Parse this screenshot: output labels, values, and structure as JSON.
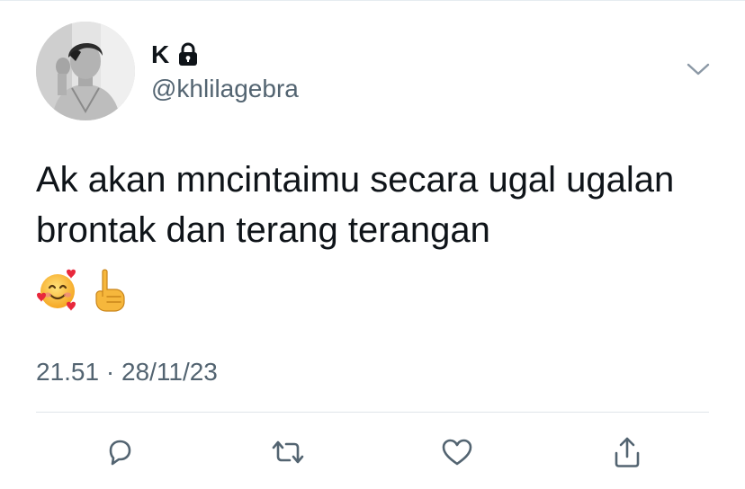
{
  "tweet": {
    "author": {
      "display_name": "K",
      "handle": "@khlilagebra",
      "protected_icon": "lock-icon",
      "avatar": "avatar-photo"
    },
    "text": "Ak akan mncintaimu secara ugal ugalan brontak dan terang terangan",
    "emojis": [
      "smiling-face-with-hearts",
      "pointing-up"
    ],
    "timestamp": "21.51 · 28/11/23",
    "menu_icon": "chevron-down-icon"
  },
  "actions": [
    {
      "name": "reply",
      "icon": "reply-icon"
    },
    {
      "name": "retweet",
      "icon": "retweet-icon"
    },
    {
      "name": "like",
      "icon": "heart-icon"
    },
    {
      "name": "share",
      "icon": "share-icon"
    }
  ],
  "colors": {
    "text_primary": "#0f1419",
    "text_secondary": "#536471",
    "icon": "#536471",
    "divider": "#dfe5ea",
    "background": "#ffffff"
  }
}
